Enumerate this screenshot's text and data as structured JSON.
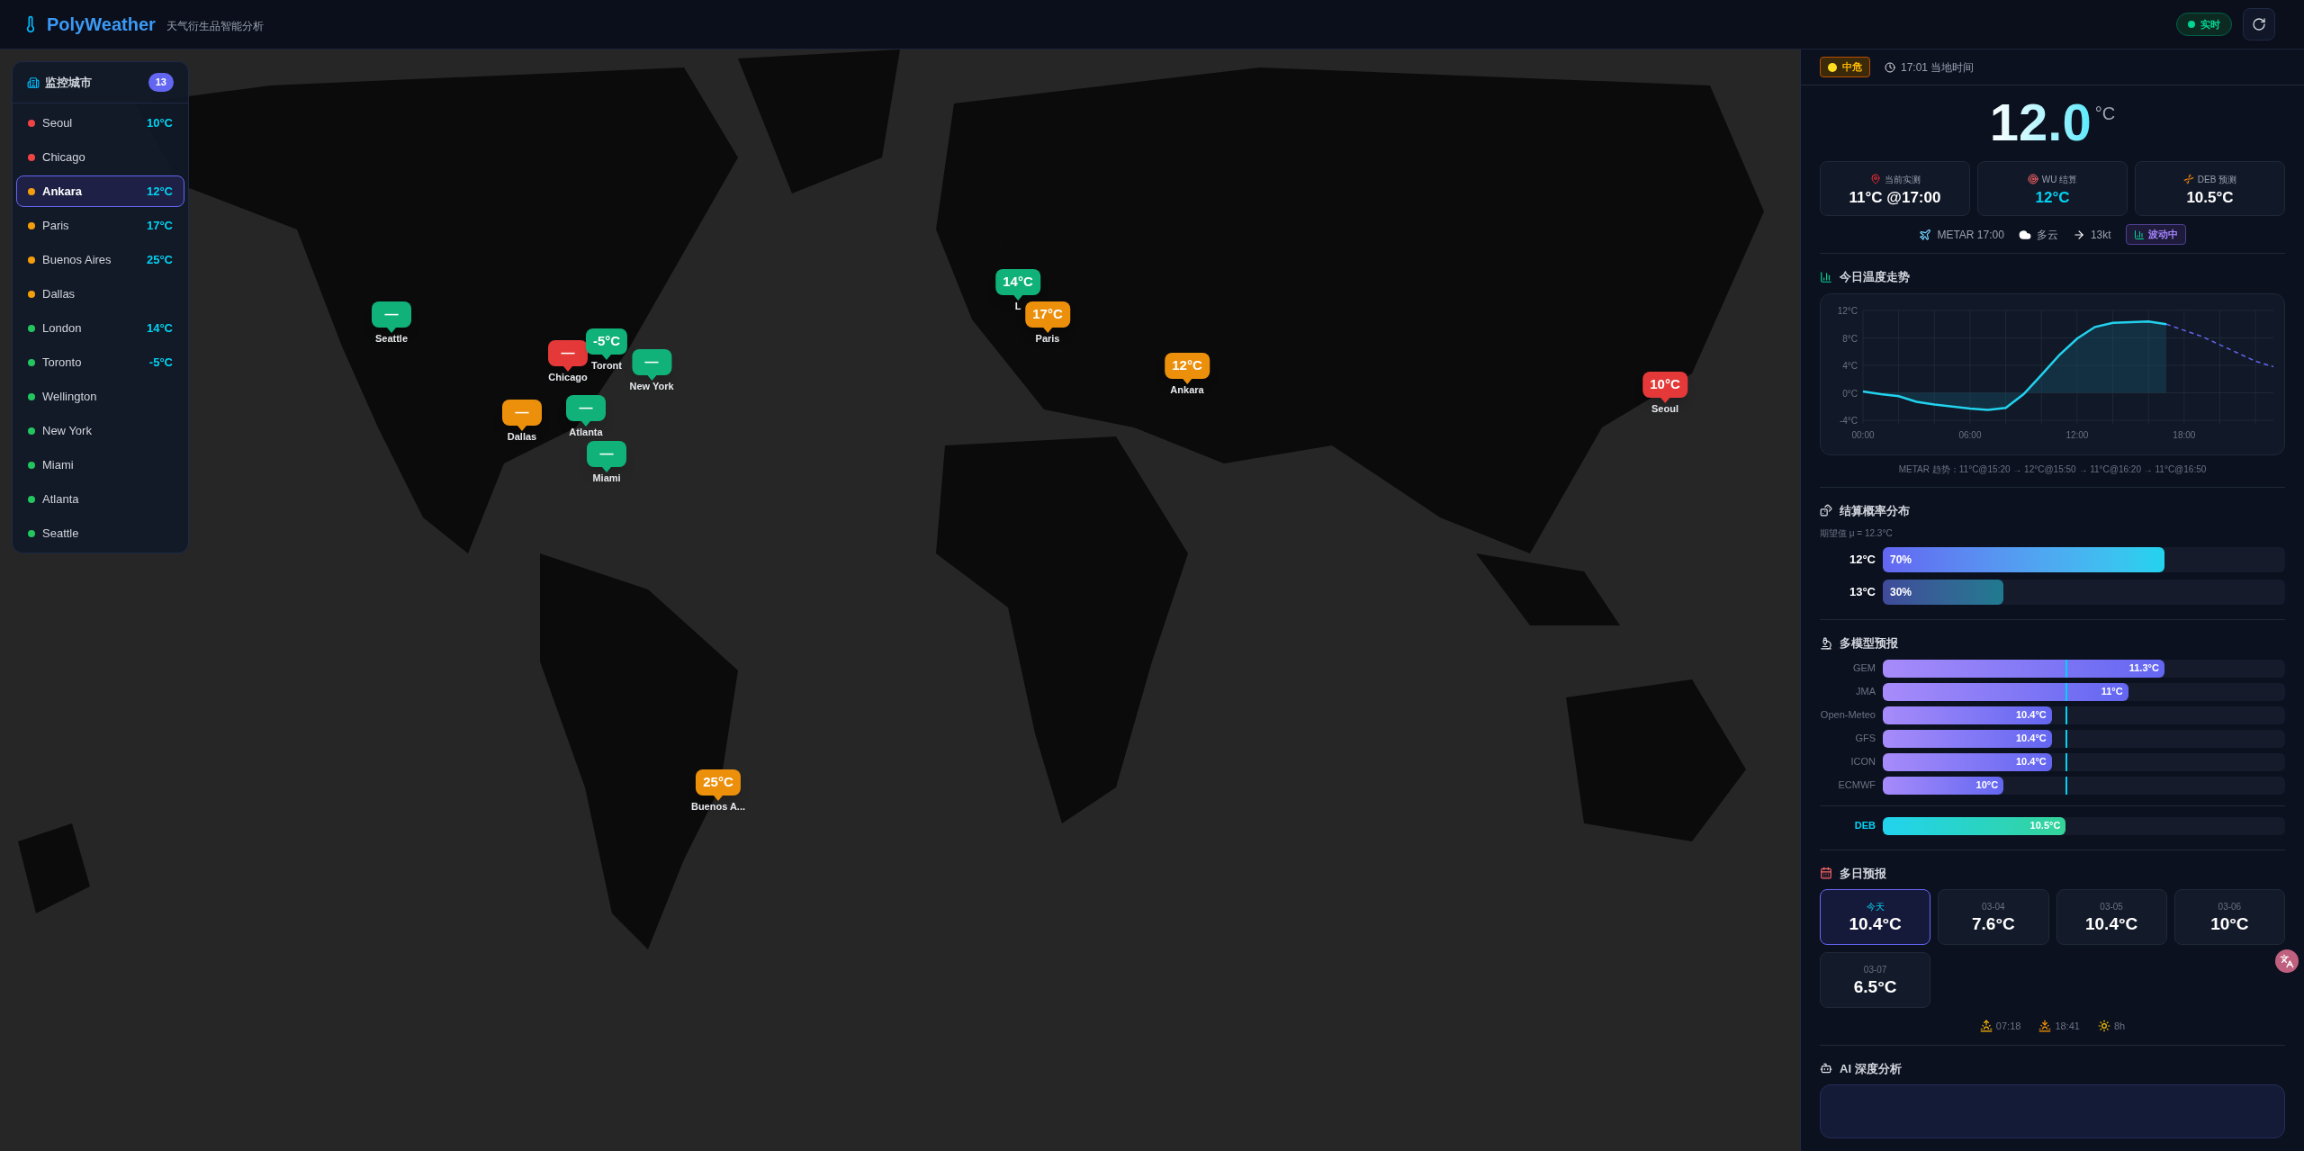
{
  "header": {
    "title": "PolyWeather",
    "subtitle": "天气衍生品智能分析",
    "live_badge": "实时"
  },
  "city_list": {
    "title": "监控城市",
    "count": "13",
    "cities": [
      {
        "name": "Seoul",
        "temp": "10°C",
        "color": "#ef4444",
        "selected": false
      },
      {
        "name": "Chicago",
        "color": "#ef4444",
        "selected": false
      },
      {
        "name": "Ankara",
        "temp": "12°C",
        "color": "#f59e0b",
        "selected": true
      },
      {
        "name": "Paris",
        "temp": "17°C",
        "color": "#f59e0b",
        "selected": false
      },
      {
        "name": "Buenos Aires",
        "temp": "25°C",
        "color": "#f59e0b",
        "selected": false
      },
      {
        "name": "Dallas",
        "color": "#f59e0b",
        "selected": false
      },
      {
        "name": "London",
        "temp": "14°C",
        "color": "#22c55e",
        "selected": false
      },
      {
        "name": "Toronto",
        "temp": "-5°C",
        "color": "#22c55e",
        "selected": false
      },
      {
        "name": "Wellington",
        "color": "#22c55e",
        "selected": false
      },
      {
        "name": "New York",
        "color": "#22c55e",
        "selected": false
      },
      {
        "name": "Miami",
        "color": "#22c55e",
        "selected": false
      },
      {
        "name": "Atlanta",
        "color": "#22c55e",
        "selected": false
      },
      {
        "name": "Seattle",
        "color": "#22c55e",
        "selected": false
      }
    ]
  },
  "map_markers": [
    {
      "value": "—",
      "label": "Seattle",
      "color": "#10b27a"
    },
    {
      "value": "—",
      "label": "Chicago",
      "color": "#e53939"
    },
    {
      "value": "-5°C",
      "label": "Toront",
      "color": "#10b27a"
    },
    {
      "value": "—",
      "label": "New York",
      "color": "#10b27a"
    },
    {
      "value": "—",
      "label": "Dallas",
      "color": "#ec900c"
    },
    {
      "value": "—",
      "label": "Atlanta",
      "color": "#10b27a"
    },
    {
      "value": "—",
      "label": "Miami",
      "color": "#10b27a"
    },
    {
      "value": "14°C",
      "label": "L",
      "color": "#10b27a"
    },
    {
      "value": "17°C",
      "label": "Paris",
      "color": "#ec900c"
    },
    {
      "value": "12°C",
      "label": "Ankara",
      "color": "#ec900c"
    },
    {
      "value": "10°C",
      "label": "Seoul",
      "color": "#e53939"
    },
    {
      "value": "25°C",
      "label": "Buenos A...",
      "color": "#ec900c"
    }
  ],
  "detail": {
    "risk_badge": "中危",
    "local_time": "17:01 当地时间",
    "temperature": "12.0",
    "unit": "°C",
    "stats": [
      {
        "label": "当前实测",
        "value": "11°C @17:00",
        "kind": "observed"
      },
      {
        "label": "WU 结算",
        "value": "12°C",
        "kind": "settlement"
      },
      {
        "label": "DEB 预测",
        "value": "10.5°C",
        "kind": "forecast"
      }
    ],
    "metar": {
      "time": "METAR 17:00",
      "sky": "多云",
      "wind": "13kt",
      "trend_badge": "波动中"
    }
  },
  "trend": {
    "title": "今日温度走势",
    "chart_data": {
      "type": "line",
      "grid": true,
      "x": [
        0,
        1,
        2,
        3,
        4,
        5,
        6,
        7,
        8,
        9,
        10,
        11,
        12,
        13,
        14,
        15,
        16,
        17,
        18,
        19,
        20,
        21,
        22,
        23
      ],
      "xlim": [
        0,
        23
      ],
      "ylim": [
        -4,
        12
      ],
      "xticks": [
        {
          "value": 0,
          "label": "00:00"
        },
        {
          "value": 6,
          "label": "06:00"
        },
        {
          "value": 12,
          "label": "12:00"
        },
        {
          "value": 18,
          "label": "18:00"
        }
      ],
      "yticks": [
        {
          "value": 12,
          "label": "12°C"
        },
        {
          "value": 8,
          "label": "8°C"
        },
        {
          "value": 4,
          "label": "4°C"
        },
        {
          "value": 0,
          "label": "0°C"
        },
        {
          "value": -4,
          "label": "-4°C"
        }
      ],
      "series": [
        {
          "color": "#22d3ee",
          "line_style": "solid",
          "values": [
            0.2,
            -0.2,
            -0.5,
            -1.3,
            -1.7,
            -2.0,
            -2.3,
            -2.5,
            -2.2,
            -0.2,
            2.6,
            5.5,
            7.9,
            9.6,
            10.2,
            10.3,
            10.4,
            10.0,
            null,
            null,
            null,
            null,
            null,
            null
          ]
        },
        {
          "color": "#6366f1",
          "line_style": "dashed",
          "values": [
            null,
            null,
            null,
            null,
            null,
            null,
            null,
            null,
            null,
            null,
            null,
            null,
            null,
            null,
            null,
            null,
            null,
            10.0,
            9.1,
            8.2,
            7.0,
            5.8,
            4.6,
            3.8
          ]
        }
      ]
    },
    "metar_trend": "METAR 趋势：11°C@15:20 → 12°C@15:50 → 11°C@16:20 → 11°C@16:50"
  },
  "probability": {
    "title": "结算概率分布",
    "expected": "期望值 μ = 12.3°C",
    "bins": [
      {
        "label": "12°C",
        "value": "70%",
        "level": 0.7,
        "kind": "top"
      },
      {
        "label": "13°C",
        "value": "30%",
        "level": 0.3,
        "kind": "other"
      }
    ]
  },
  "models": {
    "title": "多模型预报",
    "reference": {
      "level": 0.455
    },
    "rows": [
      {
        "name": "GEM",
        "value": "11.3°C",
        "level": 0.7,
        "kind": "model"
      },
      {
        "name": "JMA",
        "value": "11°C",
        "level": 0.61,
        "kind": "model"
      },
      {
        "name": "Open-Meteo",
        "value": "10.4°C",
        "level": 0.42,
        "kind": "model"
      },
      {
        "name": "GFS",
        "value": "10.4°C",
        "level": 0.42,
        "kind": "model"
      },
      {
        "name": "ICON",
        "value": "10.4°C",
        "level": 0.42,
        "kind": "model"
      },
      {
        "name": "ECMWF",
        "value": "10°C",
        "level": 0.3,
        "kind": "model"
      },
      {
        "name": "DEB",
        "value": "10.5°C",
        "level": 0.455,
        "kind": "blend"
      }
    ]
  },
  "daily": {
    "title": "多日预报",
    "days": [
      {
        "date": "今天",
        "temp": "10.4°C",
        "selected": true
      },
      {
        "date": "03-04",
        "temp": "7.6°C",
        "selected": false
      },
      {
        "date": "03-05",
        "temp": "10.4°C",
        "selected": false
      },
      {
        "date": "03-06",
        "temp": "10°C",
        "selected": false
      },
      {
        "date": "03-07",
        "temp": "6.5°C",
        "selected": false
      }
    ],
    "sunrise": "07:18",
    "sunset": "18:41",
    "daylight": "8h"
  },
  "ai": {
    "title": "AI 深度分析"
  }
}
